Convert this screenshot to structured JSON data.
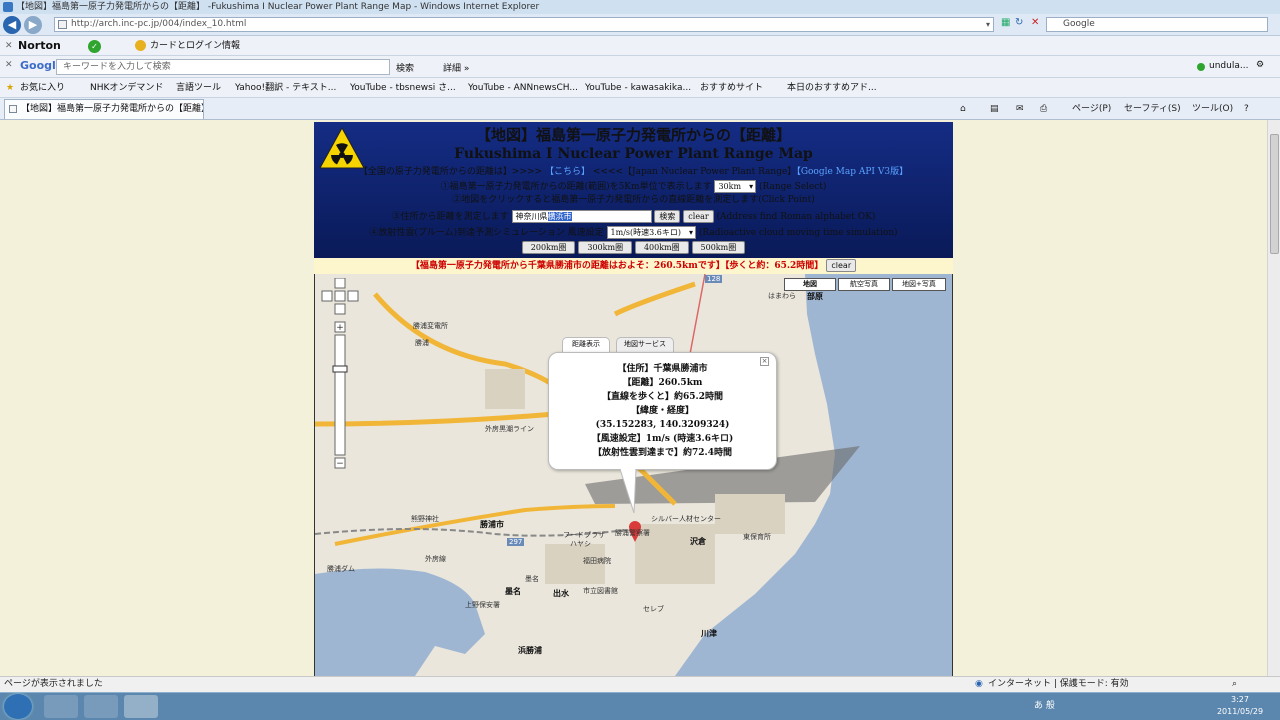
{
  "browser": {
    "title": "【地図】福島第一原子力発電所からの【距離】 -Fukushima I Nuclear Power Plant Range Map - Windows Internet Explorer",
    "url": "http://arch.inc-pc.jp/004/index_10.html",
    "search_provider": "Google",
    "norton": "Norton",
    "norton_card": "カードとログイン情報",
    "google_brand": "Google",
    "google_placeholder": "キーワードを入力して検索",
    "google_search_btn": "検索",
    "google_details": "詳細 »",
    "google_user": "undula...",
    "favorites": [
      "お気に入り",
      "NHKオンデマンド",
      "言語ツール",
      "Yahoo!翻訳 - テキスト...",
      "YouTube - tbsnewsi さ...",
      "YouTube - ANNnewsCH...",
      "YouTube - kawasakika...",
      "おすすめサイト",
      "本日のおすすめアド..."
    ],
    "tab_title": "【地図】福島第一原子力発電所からの【距離】...",
    "cmd": [
      "ページ(P)",
      "セーフティ(S)",
      "ツール(O)"
    ],
    "status_left": "ページが表示されました",
    "status_zone": "インターネット | 保護モード: 有効",
    "clock_time": "3:27",
    "clock_date": "2011/05/29",
    "tray_text": "あ 般"
  },
  "page": {
    "title_jp": "【地図】福島第一原子力発電所からの【距離】",
    "title_en": "Fukushima I Nuclear Power Plant Range Map",
    "line1_a": "【全国の原子力発電所からの距離は】>>>> ",
    "line1_link1": "【こちら】",
    "line1_b": " <<<<【Japan Nuclear Power Plant Range】",
    "line1_link2": "【Google Map API V3版】",
    "line2_a": "①福島第一原子力発電所からの距離(範囲)を5Km単位で表示します",
    "line2_select": "30km",
    "line2_b": "(Range Select)",
    "line3": "②地図をクリックすると福島第一原子力発電所からの直線距離を測定します(Click Point)",
    "line4_a": "③住所から距離を測定します",
    "line4_input": "神奈川県",
    "line4_input_sel": "横浜市",
    "line4_btn": "検索",
    "line4_clear": "clear",
    "line4_b": "(Address find Roman alphabet OK)",
    "line5_a": "④放射性雲(プルーム)到達予測シミュレーション 風速設定",
    "line5_select": "1m/s(時速3.6キロ)",
    "line5_b": "(Radioactive cloud moving time simulation)",
    "range_buttons": [
      "200km圏",
      "300km圏",
      "400km圏",
      "500km圏"
    ],
    "result": "【福島第一原子力発電所から千葉県勝浦市の距離はおよそ：260.5kmです】【歩くと約：65.2時間】",
    "result_clear": "clear"
  },
  "map": {
    "types": [
      "地図",
      "航空写真",
      "地図+写真"
    ],
    "tabs": [
      "距離表示",
      "地図サービス"
    ],
    "bubble": [
      "【住所】千葉県勝浦市",
      "【距離】260.5km",
      "【直線を歩くと】約65.2時間",
      "【緯度・経度】",
      "(35.152283, 140.3209324)",
      "【風速設定】1m/s (時速3.6キロ)",
      "【放射性雲到達まで】約72.4時間"
    ],
    "close": "×",
    "labels": [
      "勝浦変電所",
      "勝浦",
      "勝浦市",
      "沢倉",
      "出水",
      "墨名",
      "浜勝浦",
      "川津",
      "部原",
      "はまわら",
      "熊野神社",
      "外房線",
      "外房黒潮ライン",
      "フードプラザ",
      "ハヤシ",
      "シルバー人材センター",
      "東保育所",
      "セレブ",
      "市立図書館",
      "福田病院",
      "勝浦警察署",
      "墨名",
      "勝浦ダム",
      "上野保安署"
    ],
    "route_numbers": [
      "128",
      "297",
      "128"
    ]
  }
}
